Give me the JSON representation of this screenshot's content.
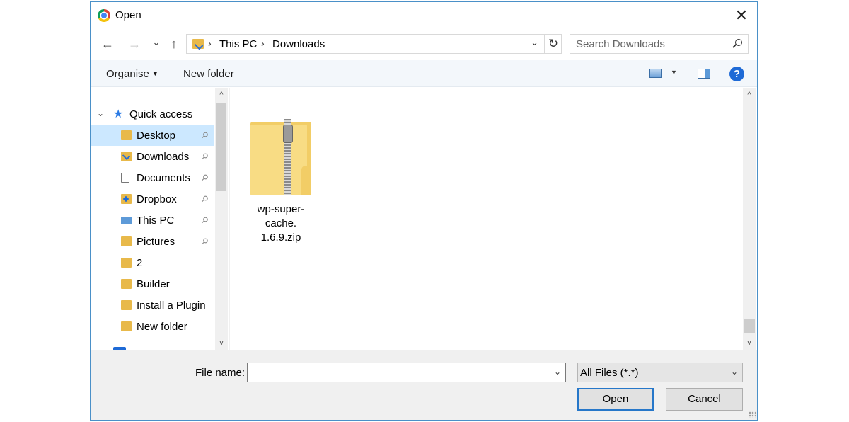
{
  "window": {
    "title": "Open",
    "close_glyph": "✕"
  },
  "nav": {
    "back_glyph": "←",
    "forward_glyph": "→",
    "recent_glyph": "⌄",
    "up_glyph": "↑",
    "breadcrumbs": [
      "This PC",
      "Downloads"
    ],
    "crumb_sep": "›",
    "dropdown_glyph": "⌄",
    "refresh_glyph": "↻",
    "search_placeholder": "Search Downloads"
  },
  "toolbar": {
    "organise_label": "Organise",
    "new_folder_label": "New folder",
    "caret_glyph": "▼",
    "help_glyph": "?"
  },
  "sidebar": {
    "quick_access_label": "Quick access",
    "expand_glyph": "⌄",
    "pin_glyph": "📌",
    "items": [
      {
        "label": "Desktop",
        "icon": "desktop-folder-icon",
        "pinned": true,
        "selected": true
      },
      {
        "label": "Downloads",
        "icon": "downloads-folder-icon",
        "pinned": true
      },
      {
        "label": "Documents",
        "icon": "documents-icon",
        "pinned": true
      },
      {
        "label": "Dropbox",
        "icon": "dropbox-folder-icon",
        "pinned": true
      },
      {
        "label": "This PC",
        "icon": "this-pc-icon",
        "pinned": true
      },
      {
        "label": "Pictures",
        "icon": "pictures-folder-icon",
        "pinned": true
      },
      {
        "label": "2",
        "icon": "folder-icon"
      },
      {
        "label": "Builder",
        "icon": "folder-icon"
      },
      {
        "label": "Install a Plugin",
        "icon": "folder-icon"
      },
      {
        "label": "New folder",
        "icon": "folder-icon"
      }
    ],
    "scroll_up_glyph": "^",
    "scroll_down_glyph": "v"
  },
  "files": [
    {
      "name_line1": "wp-super-cache.",
      "name_line2": "1.6.9.zip",
      "icon": "zip-folder-icon"
    }
  ],
  "footer": {
    "file_name_label": "File name:",
    "file_name_value": "",
    "file_type_value": "All Files (*.*)",
    "open_label": "Open",
    "cancel_label": "Cancel"
  },
  "colors": {
    "accent": "#2677c9",
    "selection": "#cce8ff",
    "toolbar_bg": "#f3f7fb",
    "folder": "#e8b94a"
  }
}
